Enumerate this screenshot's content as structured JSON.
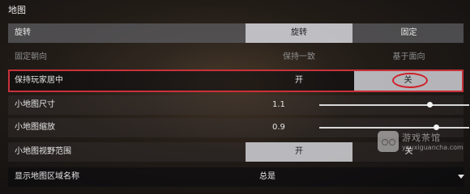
{
  "section": {
    "title": "地图"
  },
  "rows": {
    "rotate": {
      "label": "旋转",
      "options": [
        "旋转",
        "固定"
      ]
    },
    "fixed_direction": {
      "label": "固定朝向",
      "options": [
        "保持一致",
        "基于面向"
      ]
    },
    "keep_player_center": {
      "label": "保持玩家居中",
      "options": [
        "开",
        "关"
      ],
      "selected": "关"
    },
    "minimap_size": {
      "label": "小地图尺寸",
      "value": "1.1",
      "level": 0.74
    },
    "minimap_zoom": {
      "label": "小地图缩放",
      "value": "0.9",
      "level": 0.78
    },
    "minimap_view": {
      "label": "小地图视野范围",
      "options": [
        "开",
        "关"
      ]
    },
    "show_region_names": {
      "label": "显示地图区域名称",
      "value": "总是"
    }
  },
  "watermark": {
    "title": "游戏茶馆",
    "url": "youxiguancha.com"
  },
  "colors": {
    "highlight": "#c8313a",
    "active_segment": "#d2d2d7"
  }
}
